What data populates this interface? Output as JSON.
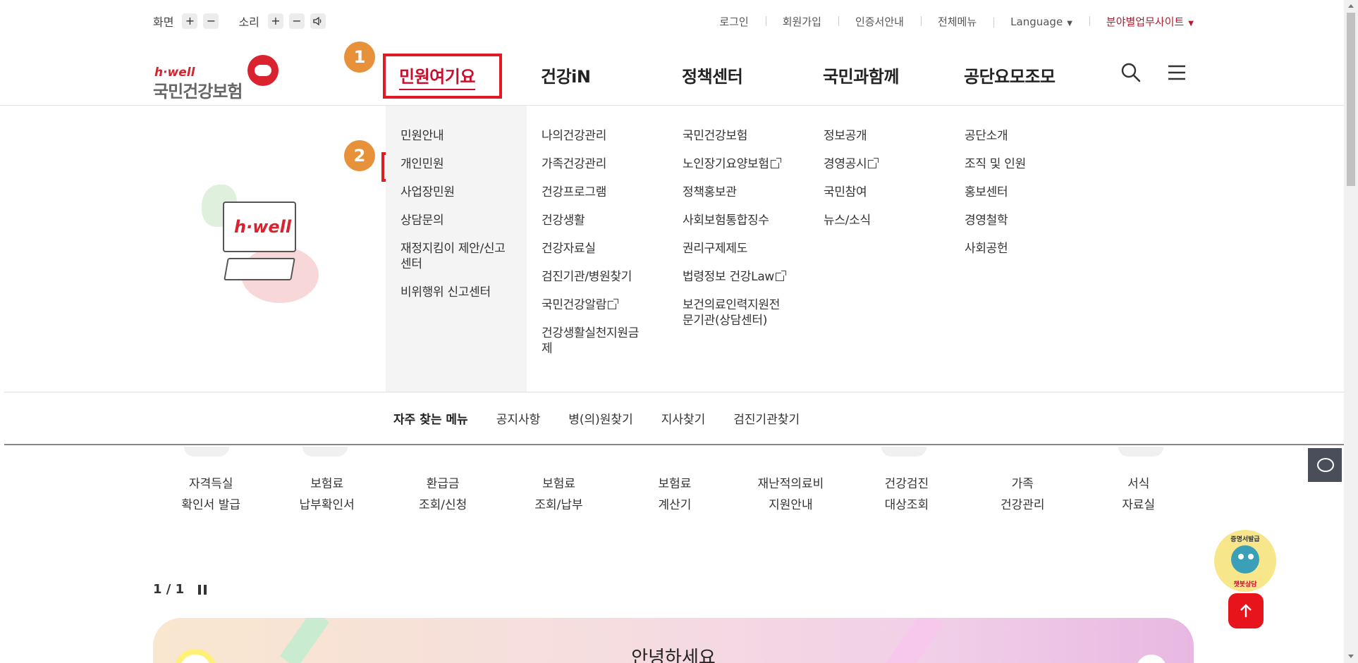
{
  "util": {
    "screen_label": "화면",
    "sound_label": "소리",
    "plus": "+",
    "minus": "−",
    "links": [
      "로그인",
      "회원가입",
      "인증서안내",
      "전체메뉴"
    ],
    "language": "Language",
    "business_site": "분야별업무사이트",
    "caret": "▼"
  },
  "logo": {
    "hwell": "h·well",
    "name": "국민건강보험"
  },
  "gnb": [
    "민원여기요",
    "건강iN",
    "정책센터",
    "국민과함께",
    "공단요모조모"
  ],
  "steps": [
    "1",
    "2"
  ],
  "illustration": {
    "monitor_text": "h·well"
  },
  "mega": {
    "col1": [
      "민원안내",
      "개인민원",
      "사업장민원",
      "상담문의",
      "재정지킴이 제안/신고\n센터",
      "비위행위 신고센터"
    ],
    "col2": [
      "나의건강관리",
      "가족건강관리",
      "건강프로그램",
      "건강생활",
      "건강자료실",
      "검진기관/병원찾기",
      "국민건강알람",
      "건강생활실천지원금\n제"
    ],
    "col3": [
      "국민건강보험",
      "노인장기요양보험",
      "정책홍보관",
      "사회보험통합징수",
      "권리구제제도",
      "법령정보 건강Law",
      "보건의료인력지원전\n문기관(상담센터)"
    ],
    "col4": [
      "정보공개",
      "경영공시",
      "국민참여",
      "뉴스/소식"
    ],
    "col5": [
      "공단소개",
      "조직 및 인원",
      "홍보센터",
      "경영철학",
      "사회공헌"
    ]
  },
  "quick": {
    "title": "자주 찾는 메뉴",
    "items": [
      "공지사항",
      "병(의)원찾기",
      "지사찾기",
      "검진기관찾기"
    ]
  },
  "services": [
    [
      "자격득실",
      "확인서 발급"
    ],
    [
      "보험료",
      "납부확인서"
    ],
    [
      "환급금",
      "조회/신청"
    ],
    [
      "보험료",
      "조회/납부"
    ],
    [
      "보험료",
      "계산기"
    ],
    [
      "재난적의료비",
      "지원안내"
    ],
    [
      "건강검진",
      "대상조회"
    ],
    [
      "가족",
      "건강관리"
    ],
    [
      "서식",
      "자료실"
    ]
  ],
  "pager": {
    "text": "1 / 1"
  },
  "banner": {
    "title": "안녕하세요"
  },
  "bot": {
    "top_text": "증명서발급",
    "bottom_text": "챗봇상담"
  },
  "colors": {
    "brand_red": "#c8102e",
    "highlight": "#e01b24",
    "step": "#e8913b"
  }
}
